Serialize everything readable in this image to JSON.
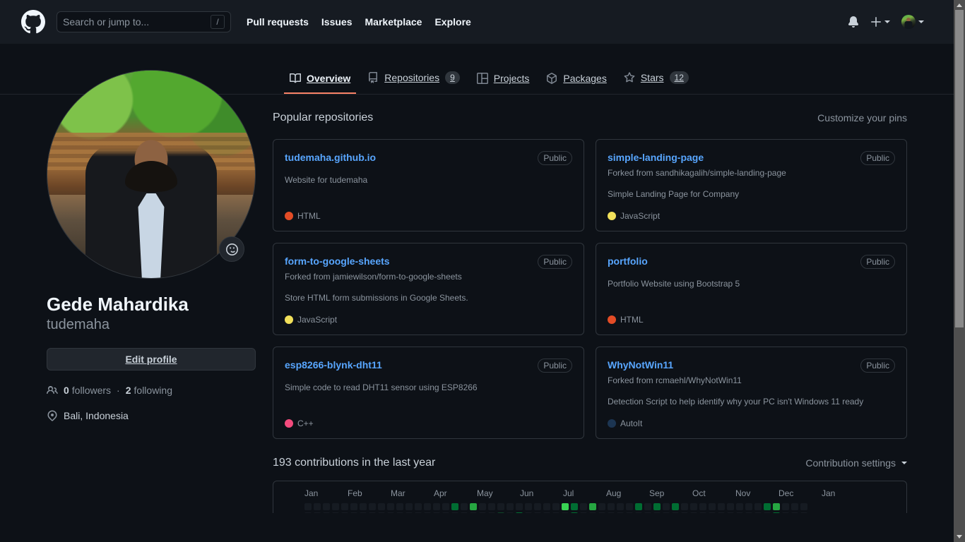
{
  "header": {
    "logo_icon": "github-mark-icon",
    "search": {
      "placeholder": "Search or jump to...",
      "shortcut": "/"
    },
    "nav": [
      {
        "label": "Pull requests"
      },
      {
        "label": "Issues"
      },
      {
        "label": "Marketplace"
      },
      {
        "label": "Explore"
      }
    ],
    "notifications_icon": "bell-icon",
    "create_new_icon": "plus-icon",
    "account_icon": "avatar"
  },
  "tabs": [
    {
      "label": "Overview",
      "icon": "book-icon",
      "count": null,
      "active": true
    },
    {
      "label": "Repositories",
      "icon": "repo-icon",
      "count": "9",
      "active": false
    },
    {
      "label": "Projects",
      "icon": "project-icon",
      "count": null,
      "active": false
    },
    {
      "label": "Packages",
      "icon": "package-icon",
      "count": null,
      "active": false
    },
    {
      "label": "Stars",
      "icon": "star-icon",
      "count": "12",
      "active": false
    }
  ],
  "profile": {
    "avatar_alt": "Gede Mahardika avatar",
    "status_icon": "smiley-icon",
    "name": "Gede Mahardika",
    "login": "tudemaha",
    "edit_label": "Edit profile",
    "followers_count": "0",
    "followers_label": "followers",
    "separator": "·",
    "following_count": "2",
    "following_label": "following",
    "people_icon": "people-icon",
    "location_icon": "location-pin-icon",
    "location": "Bali, Indonesia"
  },
  "main": {
    "section_title": "Popular repositories",
    "customize_link": "Customize your pins",
    "public_label": "Public",
    "repos": [
      {
        "name": "tudemaha.github.io",
        "fork_from": "",
        "description": "Website for tudemaha",
        "visibility": "Public",
        "language": "HTML",
        "language_color": "#e34c26"
      },
      {
        "name": "simple-landing-page",
        "fork_from": "Forked from sandhikagalih/simple-landing-page",
        "description": "Simple Landing Page for Company",
        "visibility": "Public",
        "language": "JavaScript",
        "language_color": "#f1e05a"
      },
      {
        "name": "form-to-google-sheets",
        "fork_from": "Forked from jamiewilson/form-to-google-sheets",
        "description": "Store HTML form submissions in Google Sheets.",
        "visibility": "Public",
        "language": "JavaScript",
        "language_color": "#f1e05a"
      },
      {
        "name": "portfolio",
        "fork_from": "",
        "description": "Portfolio Website using Bootstrap 5",
        "visibility": "Public",
        "language": "HTML",
        "language_color": "#e34c26"
      },
      {
        "name": "esp8266-blynk-dht11",
        "fork_from": "",
        "description": "Simple code to read DHT11 sensor using ESP8266",
        "visibility": "Public",
        "language": "C++",
        "language_color": "#f34b7d"
      },
      {
        "name": "WhyNotWin11",
        "fork_from": "Forked from rcmaehl/WhyNotWin11",
        "description": "Detection Script to help identify why your PC isn't Windows 11 ready",
        "visibility": "Public",
        "language": "AutoIt",
        "language_color": "#1C3552"
      }
    ]
  },
  "contributions": {
    "title": "193 contributions in the last year",
    "count": 193,
    "settings_label": "Contribution settings",
    "months": [
      "Jan",
      "Feb",
      "Mar",
      "Apr",
      "May",
      "Jun",
      "Jul",
      "Aug",
      "Sep",
      "Oct",
      "Nov",
      "Dec",
      "Jan"
    ],
    "levels": [
      "#161b22",
      "#0e4429",
      "#006d32",
      "#26a641",
      "#39d353"
    ],
    "weeks": [
      [
        0,
        0,
        0
      ],
      [
        0,
        0,
        0
      ],
      [
        0,
        0,
        0
      ],
      [
        0,
        0,
        0
      ],
      [
        0,
        0,
        0
      ],
      [
        0,
        0,
        0
      ],
      [
        0,
        0,
        0
      ],
      [
        0,
        0,
        0
      ],
      [
        0,
        0,
        0
      ],
      [
        0,
        0,
        0
      ],
      [
        0,
        0,
        0
      ],
      [
        0,
        0,
        0
      ],
      [
        0,
        0,
        0
      ],
      [
        0,
        0,
        0
      ],
      [
        0,
        0,
        0
      ],
      [
        0,
        0,
        0
      ],
      [
        2,
        0,
        0
      ],
      [
        0,
        0,
        0
      ],
      [
        3,
        0,
        0
      ],
      [
        0,
        0,
        0
      ],
      [
        0,
        0,
        0
      ],
      [
        0,
        1,
        0
      ],
      [
        0,
        0,
        0
      ],
      [
        0,
        2,
        0
      ],
      [
        0,
        0,
        0
      ],
      [
        0,
        0,
        0
      ],
      [
        0,
        0,
        0
      ],
      [
        0,
        0,
        0
      ],
      [
        4,
        0,
        0
      ],
      [
        2,
        2,
        0
      ],
      [
        0,
        0,
        0
      ],
      [
        3,
        0,
        0
      ],
      [
        0,
        0,
        0
      ],
      [
        0,
        0,
        0
      ],
      [
        0,
        0,
        0
      ],
      [
        0,
        0,
        0
      ],
      [
        2,
        0,
        0
      ],
      [
        0,
        0,
        0
      ],
      [
        2,
        0,
        0
      ],
      [
        0,
        0,
        0
      ],
      [
        2,
        0,
        0
      ],
      [
        0,
        0,
        0
      ],
      [
        0,
        0,
        0
      ],
      [
        0,
        0,
        0
      ],
      [
        0,
        0,
        0
      ],
      [
        0,
        0,
        0
      ],
      [
        0,
        0,
        0
      ],
      [
        0,
        0,
        0
      ],
      [
        0,
        0,
        0
      ],
      [
        0,
        0,
        0
      ],
      [
        2,
        0,
        0
      ],
      [
        3,
        2,
        0
      ],
      [
        0,
        0,
        0
      ],
      [
        0,
        0,
        0
      ],
      [
        0,
        0,
        0
      ]
    ]
  },
  "colors": {
    "page_bg": "#0d1117",
    "header_bg": "#161b22",
    "border": "#30363d",
    "link": "#58a6ff",
    "muted": "#8b949e",
    "accent_underline": "#f78166"
  }
}
